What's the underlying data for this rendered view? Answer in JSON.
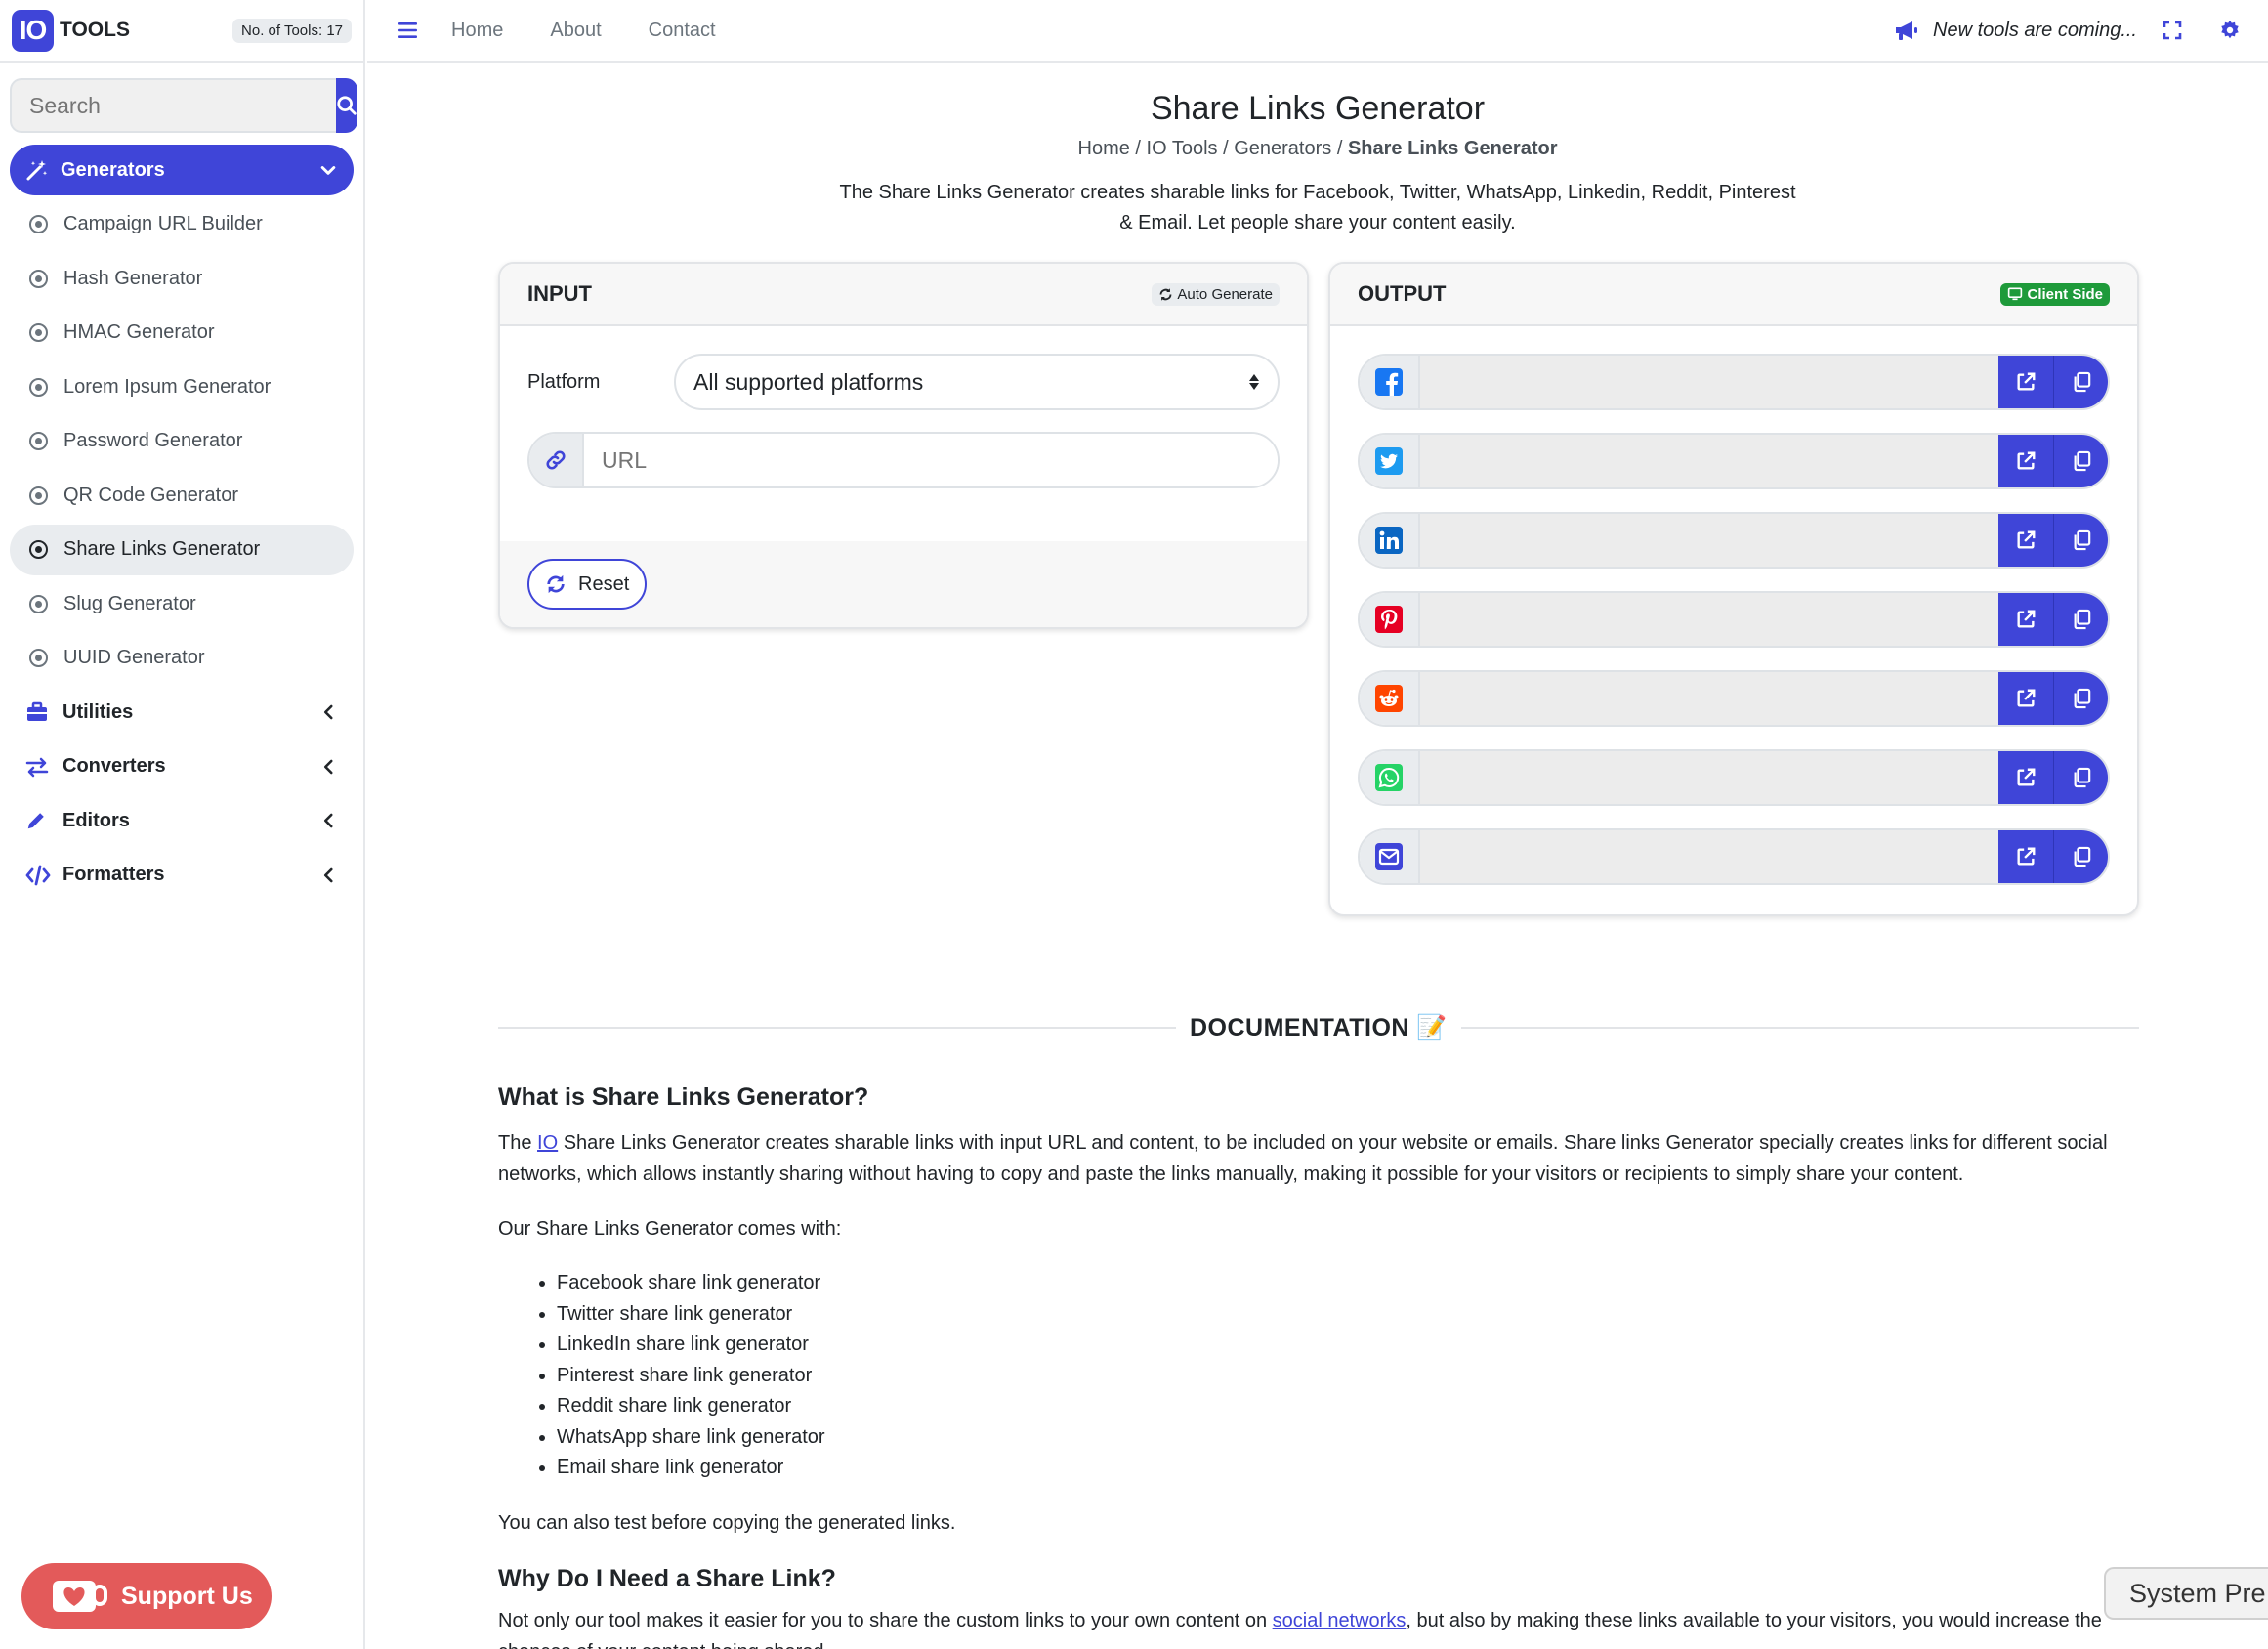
{
  "brand": {
    "logo": "IO",
    "name": "TOOLS",
    "tool_count": "No. of Tools: 17"
  },
  "search": {
    "placeholder": "Search"
  },
  "sidebar": {
    "active_category": "Generators",
    "sub_items": [
      "Campaign URL Builder",
      "Hash Generator",
      "HMAC Generator",
      "Lorem Ipsum Generator",
      "Password Generator",
      "QR Code Generator",
      "Share Links Generator",
      "Slug Generator",
      "UUID Generator"
    ],
    "selected_index": 6,
    "categories": [
      "Utilities",
      "Converters",
      "Editors",
      "Formatters"
    ]
  },
  "support": {
    "label": "Support Us"
  },
  "topbar": {
    "links": [
      "Home",
      "About",
      "Contact"
    ],
    "announcement": "New tools are coming..."
  },
  "page": {
    "title": "Share Links Generator",
    "breadcrumb": {
      "home": "Home",
      "io_tools": "IO Tools",
      "generators": "Generators",
      "current": "Share Links Generator",
      "sep": " / "
    },
    "intro": "The Share Links Generator creates sharable links for Facebook, Twitter, WhatsApp, Linkedin, Reddit, Pinterest & Email. Let people share your content easily."
  },
  "input_card": {
    "title": "INPUT",
    "badge": "Auto Generate",
    "platform_label": "Platform",
    "platform_value": "All supported platforms",
    "url_placeholder": "URL",
    "reset_label": "Reset"
  },
  "output_card": {
    "title": "OUTPUT",
    "badge": "Client Side",
    "rows": [
      "facebook",
      "twitter",
      "linkedin",
      "pinterest",
      "reddit",
      "whatsapp",
      "email"
    ]
  },
  "colors": {
    "primary": "#3f45d8",
    "facebook": "#1877f2",
    "twitter": "#1d9bf0",
    "linkedin": "#0a66c2",
    "pinterest": "#e60023",
    "reddit": "#ff4500",
    "whatsapp": "#25d366",
    "email": "#3f45d8",
    "support": "#e35a5a",
    "client_side": "#1e9a3a"
  },
  "documentation": {
    "heading": "DOCUMENTATION 📝",
    "h1": "What is Share Links Generator?",
    "p1_pre": "The ",
    "p1_link": "IO",
    "p1_post": " Share Links Generator creates sharable links with input URL and content,  to be included on your website or emails. Share links Generator specially creates links for different social networks, which allows instantly sharing without having to copy and paste the links manually, making it possible for your visitors or recipients to simply share your content.",
    "p2": "Our Share Links Generator comes with:",
    "features": [
      "Facebook share link generator",
      "Twitter share link generator",
      "LinkedIn share link generator",
      "Pinterest share link generator",
      "Reddit share link generator",
      "WhatsApp share link generator",
      "Email share link generator"
    ],
    "p3": "You can also test before copying the generated links.",
    "h2": "Why Do I Need a Share Link?",
    "p4_pre": "Not only our tool makes it easier for you to share the custom links to your own content on ",
    "p4_link": "social networks",
    "p4_post": ", but also by making these links available to your visitors, you would increase the chances of your content being shared."
  },
  "system_pref": {
    "label": "System Pre"
  }
}
